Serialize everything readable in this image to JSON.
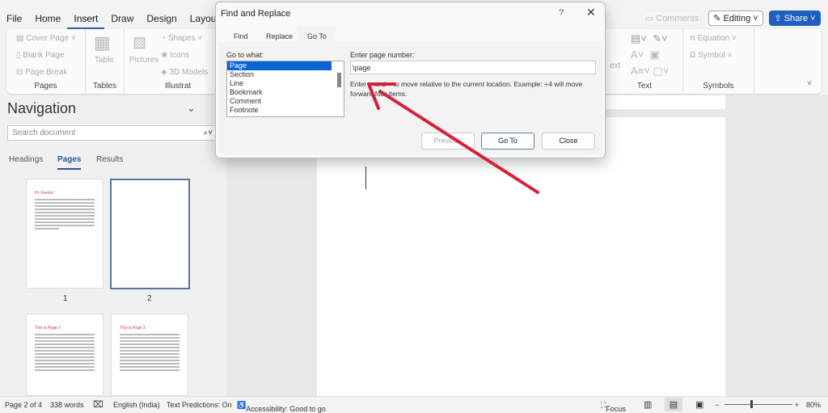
{
  "menu": [
    "File",
    "Home",
    "Insert",
    "Draw",
    "Design",
    "Layout"
  ],
  "ribbon": {
    "pages": {
      "items": [
        "Cover Page",
        "Blank Page",
        "Page Break"
      ],
      "label": "Pages"
    },
    "tables": {
      "item": "Table",
      "label": "Tables"
    },
    "illustrations": {
      "items": [
        "Pictures",
        "Shapes",
        "Icons",
        "3D Models"
      ],
      "label": "Illustrat"
    },
    "text": {
      "label": "Text",
      "partial": "ext"
    },
    "symbols": {
      "items": [
        "Equation",
        "Symbol"
      ],
      "label": "Symbols"
    }
  },
  "top_right": {
    "comments": "Comments",
    "editing": "Editing",
    "share": "Share",
    "accent": "#1f5fbf"
  },
  "navigation": {
    "title": "Navigation",
    "search_placeholder": "Search document",
    "tabs": [
      "Headings",
      "Pages",
      "Results"
    ],
    "active_tab": "Pages",
    "thumbs": [
      {
        "title": "Hi, Geeks!",
        "num": "1"
      },
      {
        "title": "",
        "num": "2"
      },
      {
        "title": "This is Page 3"
      },
      {
        "title": "This is Page 3"
      }
    ]
  },
  "dialog": {
    "title": "Find and Replace",
    "help": "?",
    "tabs": [
      "Find",
      "Replace",
      "Go To"
    ],
    "active_tab": "Go To",
    "goto_label": "Go to what:",
    "goto_items": [
      "Page",
      "Section",
      "Line",
      "Bookmark",
      "Comment",
      "Footnote"
    ],
    "selected": "Page",
    "input_label": "Enter page number:",
    "input_value": "\\page",
    "hint": "Enter + and – to move relative to the current location. Example: +4 will move forward four items.",
    "buttons": {
      "previous": "Previous",
      "goto": "Go To",
      "close": "Close"
    }
  },
  "status": {
    "page": "Page 2 of 4",
    "words": "338 words",
    "language": "English (India)",
    "predictions": "Text Predictions: On",
    "accessibility": "Accessibility: Good to go",
    "focus": "Focus",
    "zoom": "80%",
    "zoom_percent": 80
  },
  "annotation_color": "#d8203a"
}
